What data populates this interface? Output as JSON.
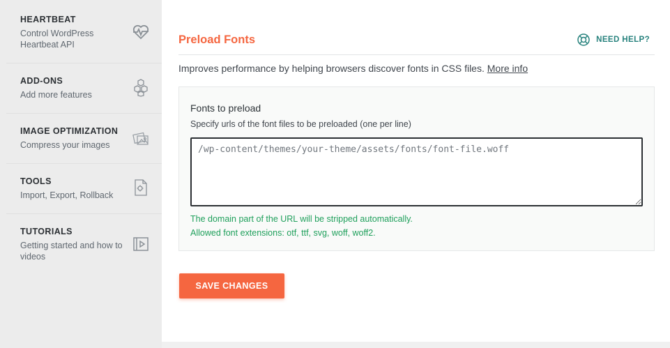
{
  "sidebar": {
    "items": [
      {
        "title": "HEARTBEAT",
        "desc": "Control WordPress Heartbeat API",
        "icon": "heartbeat-icon"
      },
      {
        "title": "ADD-ONS",
        "desc": "Add more features",
        "icon": "cubes-icon"
      },
      {
        "title": "IMAGE OPTIMIZATION",
        "desc": "Compress your images",
        "icon": "images-icon"
      },
      {
        "title": "TOOLS",
        "desc": "Import, Export, Rollback",
        "icon": "file-gear-icon"
      },
      {
        "title": "TUTORIALS",
        "desc": "Getting started and how to videos",
        "icon": "video-icon"
      }
    ]
  },
  "section": {
    "title": "Preload Fonts",
    "help_label": "NEED HELP?",
    "intro": "Improves performance by helping browsers discover fonts in CSS files.",
    "more_info": "More info"
  },
  "field": {
    "label": "Fonts to preload",
    "desc": "Specify urls of the font files to be preloaded (one per line)",
    "placeholder": "/wp-content/themes/your-theme/assets/fonts/font-file.woff",
    "value": "",
    "note_1": "The domain part of the URL will be stripped automatically.",
    "note_2": "Allowed font extensions: otf, ttf, svg, woff, woff2."
  },
  "actions": {
    "save_label": "SAVE CHANGES"
  },
  "colors": {
    "accent": "#f56640",
    "help": "#27827d",
    "note": "#20a05c"
  }
}
